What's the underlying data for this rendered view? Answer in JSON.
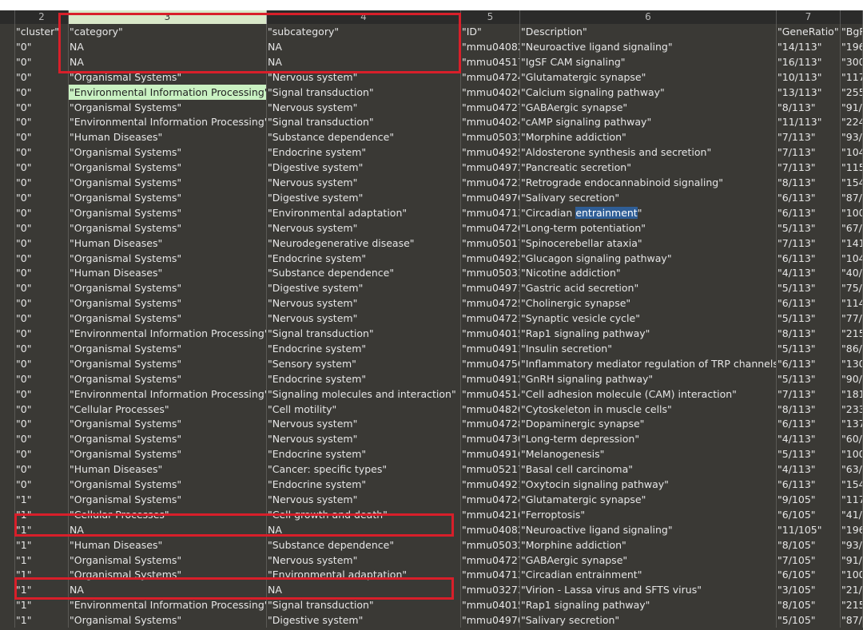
{
  "column_headers": [
    "2",
    "3",
    "4",
    "5",
    "6",
    "7",
    ""
  ],
  "selected_column": "3",
  "highlight_color": "#c9f1c2",
  "annotation_color": "#d81f2a",
  "text_selection": "entrainment",
  "rows": [
    [
      "\"cluster\"",
      "\"category\"",
      "\"subcategory\"",
      "\"ID\"",
      "\"Description\"",
      "\"GeneRatio\"",
      "\"BgR"
    ],
    [
      "\"0\"",
      "NA",
      "NA",
      "\"mmu04082\"",
      "\"Neuroactive ligand signaling\"",
      "\"14/113\"",
      "\"196"
    ],
    [
      "\"0\"",
      "NA",
      "NA",
      "\"mmu04517\"",
      "\"IgSF CAM signaling\"",
      "\"16/113\"",
      "\"300"
    ],
    [
      "\"0\"",
      "\"Organismal Systems\"",
      "\"Nervous system\"",
      "\"mmu04724\"",
      "\"Glutamatergic synapse\"",
      "\"10/113\"",
      "\"117"
    ],
    [
      "\"0\"",
      "\"Environmental Information Processing\"",
      "\"Signal transduction\"",
      "\"mmu04020\"",
      "\"Calcium signaling pathway\"",
      "\"13/113\"",
      "\"255"
    ],
    [
      "\"0\"",
      "\"Organismal Systems\"",
      "\"Nervous system\"",
      "\"mmu04727\"",
      "\"GABAergic synapse\"",
      "\"8/113\"",
      "\"91/"
    ],
    [
      "\"0\"",
      "\"Environmental Information Processing\"",
      "\"Signal transduction\"",
      "\"mmu04024\"",
      "\"cAMP signaling pathway\"",
      "\"11/113\"",
      "\"224"
    ],
    [
      "\"0\"",
      "\"Human Diseases\"",
      "\"Substance dependence\"",
      "\"mmu05032\"",
      "\"Morphine addiction\"",
      "\"7/113\"",
      "\"93/"
    ],
    [
      "\"0\"",
      "\"Organismal Systems\"",
      "\"Endocrine system\"",
      "\"mmu04925\"",
      "\"Aldosterone synthesis and secretion\"",
      "\"7/113\"",
      "\"104"
    ],
    [
      "\"0\"",
      "\"Organismal Systems\"",
      "\"Digestive system\"",
      "\"mmu04972\"",
      "\"Pancreatic secretion\"",
      "\"7/113\"",
      "\"115"
    ],
    [
      "\"0\"",
      "\"Organismal Systems\"",
      "\"Nervous system\"",
      "\"mmu04723\"",
      "\"Retrograde endocannabinoid signaling\"",
      "\"8/113\"",
      "\"154"
    ],
    [
      "\"0\"",
      "\"Organismal Systems\"",
      "\"Digestive system\"",
      "\"mmu04970\"",
      "\"Salivary secretion\"",
      "\"6/113\"",
      "\"87/"
    ],
    [
      "\"0\"",
      "\"Organismal Systems\"",
      "\"Environmental adaptation\"",
      "\"mmu04713\"",
      "\"Circadian entrainment\"",
      "\"6/113\"",
      "\"100"
    ],
    [
      "\"0\"",
      "\"Organismal Systems\"",
      "\"Nervous system\"",
      "\"mmu04720\"",
      "\"Long-term potentiation\"",
      "\"5/113\"",
      "\"67/"
    ],
    [
      "\"0\"",
      "\"Human Diseases\"",
      "\"Neurodegenerative disease\"",
      "\"mmu05017\"",
      "\"Spinocerebellar ataxia\"",
      "\"7/113\"",
      "\"141"
    ],
    [
      "\"0\"",
      "\"Organismal Systems\"",
      "\"Endocrine system\"",
      "\"mmu04922\"",
      "\"Glucagon signaling pathway\"",
      "\"6/113\"",
      "\"104"
    ],
    [
      "\"0\"",
      "\"Human Diseases\"",
      "\"Substance dependence\"",
      "\"mmu05033\"",
      "\"Nicotine addiction\"",
      "\"4/113\"",
      "\"40/"
    ],
    [
      "\"0\"",
      "\"Organismal Systems\"",
      "\"Digestive system\"",
      "\"mmu04971\"",
      "\"Gastric acid secretion\"",
      "\"5/113\"",
      "\"75/"
    ],
    [
      "\"0\"",
      "\"Organismal Systems\"",
      "\"Nervous system\"",
      "\"mmu04725\"",
      "\"Cholinergic synapse\"",
      "\"6/113\"",
      "\"114"
    ],
    [
      "\"0\"",
      "\"Organismal Systems\"",
      "\"Nervous system\"",
      "\"mmu04721\"",
      "\"Synaptic vesicle cycle\"",
      "\"5/113\"",
      "\"77/"
    ],
    [
      "\"0\"",
      "\"Environmental Information Processing\"",
      "\"Signal transduction\"",
      "\"mmu04015\"",
      "\"Rap1 signaling pathway\"",
      "\"8/113\"",
      "\"215"
    ],
    [
      "\"0\"",
      "\"Organismal Systems\"",
      "\"Endocrine system\"",
      "\"mmu04911\"",
      "\"Insulin secretion\"",
      "\"5/113\"",
      "\"86/"
    ],
    [
      "\"0\"",
      "\"Organismal Systems\"",
      "\"Sensory system\"",
      "\"mmu04750\"",
      "\"Inflammatory mediator regulation of TRP channels\"",
      "\"6/113\"",
      "\"130"
    ],
    [
      "\"0\"",
      "\"Organismal Systems\"",
      "\"Endocrine system\"",
      "\"mmu04912\"",
      "\"GnRH signaling pathway\"",
      "\"5/113\"",
      "\"90/"
    ],
    [
      "\"0\"",
      "\"Environmental Information Processing\"",
      "\"Signaling molecules and interaction\"",
      "\"mmu04514\"",
      "\"Cell adhesion molecule (CAM) interaction\"",
      "\"7/113\"",
      "\"181"
    ],
    [
      "\"0\"",
      "\"Cellular Processes\"",
      "\"Cell motility\"",
      "\"mmu04820\"",
      "\"Cytoskeleton in muscle cells\"",
      "\"8/113\"",
      "\"233"
    ],
    [
      "\"0\"",
      "\"Organismal Systems\"",
      "\"Nervous system\"",
      "\"mmu04728\"",
      "\"Dopaminergic synapse\"",
      "\"6/113\"",
      "\"137"
    ],
    [
      "\"0\"",
      "\"Organismal Systems\"",
      "\"Nervous system\"",
      "\"mmu04730\"",
      "\"Long-term depression\"",
      "\"4/113\"",
      "\"60/"
    ],
    [
      "\"0\"",
      "\"Organismal Systems\"",
      "\"Endocrine system\"",
      "\"mmu04916\"",
      "\"Melanogenesis\"",
      "\"5/113\"",
      "\"100"
    ],
    [
      "\"0\"",
      "\"Human Diseases\"",
      "\"Cancer: specific types\"",
      "\"mmu05217\"",
      "\"Basal cell carcinoma\"",
      "\"4/113\"",
      "\"63/"
    ],
    [
      "\"0\"",
      "\"Organismal Systems\"",
      "\"Endocrine system\"",
      "\"mmu04921\"",
      "\"Oxytocin signaling pathway\"",
      "\"6/113\"",
      "\"154"
    ],
    [
      "\"1\"",
      "\"Organismal Systems\"",
      "\"Nervous system\"",
      "\"mmu04724\"",
      "\"Glutamatergic synapse\"",
      "\"9/105\"",
      "\"117"
    ],
    [
      "\"1\"",
      "\"Cellular Processes\"",
      "\"Cell growth and death\"",
      "\"mmu04216\"",
      "\"Ferroptosis\"",
      "\"6/105\"",
      "\"41/"
    ],
    [
      "\"1\"",
      "NA",
      "NA",
      "\"mmu04082\"",
      "\"Neuroactive ligand signaling\"",
      "\"11/105\"",
      "\"196"
    ],
    [
      "\"1\"",
      "\"Human Diseases\"",
      "\"Substance dependence\"",
      "\"mmu05032\"",
      "\"Morphine addiction\"",
      "\"8/105\"",
      "\"93/"
    ],
    [
      "\"1\"",
      "\"Organismal Systems\"",
      "\"Nervous system\"",
      "\"mmu04727\"",
      "\"GABAergic synapse\"",
      "\"7/105\"",
      "\"91/"
    ],
    [
      "\"1\"",
      "\"Organismal Systems\"",
      "\"Environmental adaptation\"",
      "\"mmu04713\"",
      "\"Circadian entrainment\"",
      "\"6/105\"",
      "\"100"
    ],
    [
      "\"1\"",
      "NA",
      "NA",
      "\"mmu03273\"",
      "\"Virion - Lassa virus and SFTS virus\"",
      "\"3/105\"",
      "\"21/"
    ],
    [
      "\"1\"",
      "\"Environmental Information Processing\"",
      "\"Signal transduction\"",
      "\"mmu04015\"",
      "\"Rap1 signaling pathway\"",
      "\"8/105\"",
      "\"215"
    ],
    [
      "\"1\"",
      "\"Organismal Systems\"",
      "\"Digestive system\"",
      "\"mmu04970\"",
      "\"Salivary secretion\"",
      "\"5/105\"",
      "\"87/"
    ]
  ]
}
